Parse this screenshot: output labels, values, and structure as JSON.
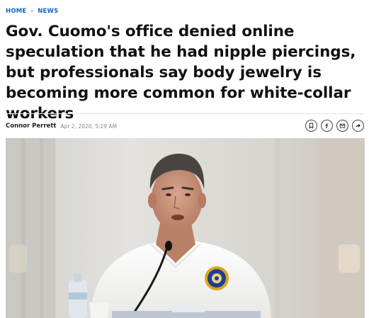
{
  "breadcrumb": {
    "home": "HOME",
    "separator": "›",
    "section": "NEWS"
  },
  "headline": "Gov. Cuomo's office denied online speculation that he had nipple piercings, but professionals say body jewelry is becoming more common for white-collar workers",
  "byline": {
    "author": "Connor Perrett",
    "date": "Apr 2, 2020, 5:29 AM"
  },
  "share_buttons": [
    {
      "icon": "bookmark-icon"
    },
    {
      "icon": "facebook-icon"
    },
    {
      "icon": "email-icon"
    },
    {
      "icon": "share-icon"
    }
  ],
  "image": {
    "subject": "photo-man-speaking-at-microphone",
    "colors": {
      "background": "#d9d8d4",
      "shirt": "#f4f4f2",
      "skin": "#c9927a",
      "hair": "#4a4440",
      "seal_blue": "#1f3f8f",
      "seal_gold": "#d9a520"
    }
  }
}
